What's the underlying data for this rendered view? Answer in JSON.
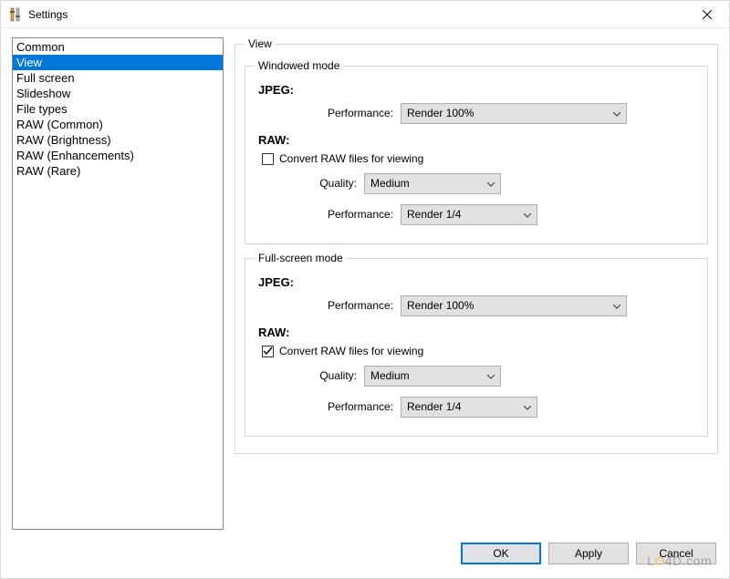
{
  "window": {
    "title": "Settings",
    "icon": "settings-app-icon"
  },
  "sidebar": {
    "items": [
      "Common",
      "View",
      "Full screen",
      "Slideshow",
      "File types",
      "RAW (Common)",
      "RAW (Brightness)",
      "RAW (Enhancements)",
      "RAW (Rare)"
    ],
    "selected": "View"
  },
  "main": {
    "legend": "View",
    "windowed": {
      "legend": "Windowed mode",
      "jpeg_label": "JPEG:",
      "jpeg_perf_label": "Performance:",
      "jpeg_perf_value": "Render 100%",
      "raw_label": "RAW:",
      "raw_convert_checked": false,
      "raw_convert_label": "Convert RAW files for viewing",
      "raw_quality_label": "Quality:",
      "raw_quality_value": "Medium",
      "raw_perf_label": "Performance:",
      "raw_perf_value": "Render 1/4"
    },
    "fullscreen": {
      "legend": "Full-screen mode",
      "jpeg_label": "JPEG:",
      "jpeg_perf_label": "Performance:",
      "jpeg_perf_value": "Render 100%",
      "raw_label": "RAW:",
      "raw_convert_checked": true,
      "raw_convert_label": "Convert RAW files for viewing",
      "raw_quality_label": "Quality:",
      "raw_quality_value": "Medium",
      "raw_perf_label": "Performance:",
      "raw_perf_value": "Render 1/4"
    }
  },
  "buttons": {
    "ok": "OK",
    "apply": "Apply",
    "cancel": "Cancel"
  },
  "watermark": "LO4D.com"
}
